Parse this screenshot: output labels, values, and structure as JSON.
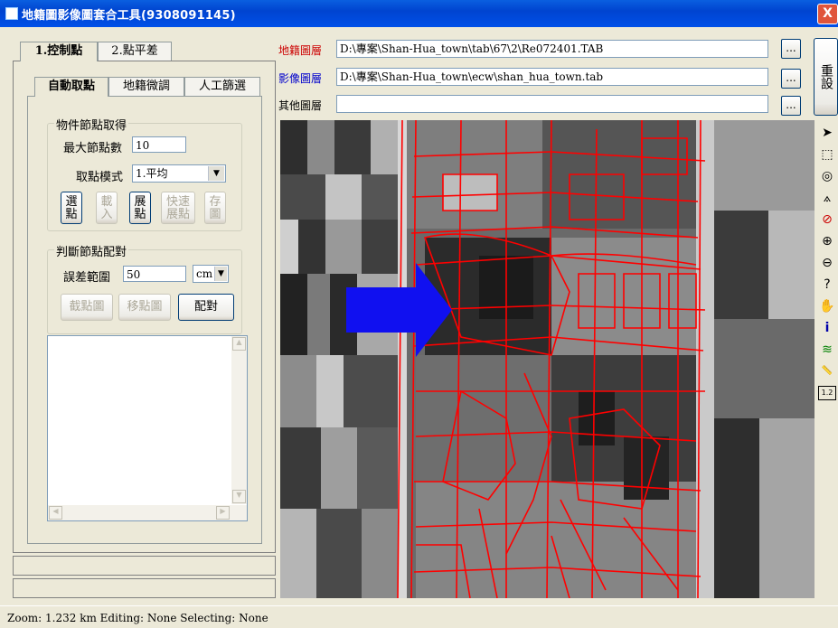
{
  "window": {
    "title": "地籍圖影像圖套合工具(9308091145)",
    "close_label": "X"
  },
  "main_tabs": [
    {
      "label": "1.控制點"
    },
    {
      "label": "2.點平差"
    }
  ],
  "sub_tabs": [
    {
      "label": "自動取點"
    },
    {
      "label": "地籍微調"
    },
    {
      "label": "人工篩選"
    }
  ],
  "group_object": {
    "title": "物件節點取得",
    "max_nodes_label": "最大節點數",
    "max_nodes_value": "10",
    "mode_label": "取點模式",
    "mode_value": "1.平均",
    "buttons": [
      {
        "label": "選點",
        "enabled": true
      },
      {
        "label": "載入",
        "enabled": false
      },
      {
        "label": "展點",
        "enabled": true
      },
      {
        "label": "快速展點",
        "enabled": false
      },
      {
        "label": "存圖",
        "enabled": false
      }
    ]
  },
  "group_match": {
    "title": "判斷節點配對",
    "tolerance_label": "誤差範圍",
    "tolerance_value": "50",
    "unit_value": "cm",
    "buttons": [
      {
        "label": "截點圖",
        "enabled": false
      },
      {
        "label": "移點圖",
        "enabled": false
      },
      {
        "label": "配對",
        "enabled": true
      }
    ]
  },
  "layers": {
    "cadastral_label": "地籍圖層",
    "cadastral_path": "D:\\專案\\Shan-Hua_town\\tab\\67\\2\\Re072401.TAB",
    "image_label": "影像圖層",
    "image_path": "D:\\專案\\Shan-Hua_town\\ecw\\shan_hua_town.tab",
    "other_label": "其他圖層",
    "other_path": "",
    "browse_label": "...",
    "reset_label": "重設"
  },
  "colors": {
    "cadastral_label": "#CC0000",
    "image_label": "#0000CC",
    "parcel_lines": "#FF0000",
    "arrow": "#1010F0"
  },
  "tools": [
    {
      "name": "select-arrow-icon",
      "glyph": "➤"
    },
    {
      "name": "rect-select-icon",
      "glyph": "⬚"
    },
    {
      "name": "radius-select-icon",
      "glyph": "◎"
    },
    {
      "name": "polygon-select-icon",
      "glyph": "⟑"
    },
    {
      "name": "clear-selection-icon",
      "glyph": "⊘"
    },
    {
      "name": "zoom-in-icon",
      "glyph": "⊕"
    },
    {
      "name": "zoom-out-icon",
      "glyph": "⊖"
    },
    {
      "name": "zoom-custom-icon",
      "glyph": "?"
    },
    {
      "name": "pan-hand-icon",
      "glyph": "✋"
    },
    {
      "name": "info-icon",
      "glyph": "i"
    },
    {
      "name": "layer-control-icon",
      "glyph": "≋"
    },
    {
      "name": "ruler-icon",
      "glyph": "📏"
    },
    {
      "name": "label-icon",
      "glyph": "1.2"
    }
  ],
  "status": "Zoom: 1.232 km   Editing: None   Selecting: None"
}
